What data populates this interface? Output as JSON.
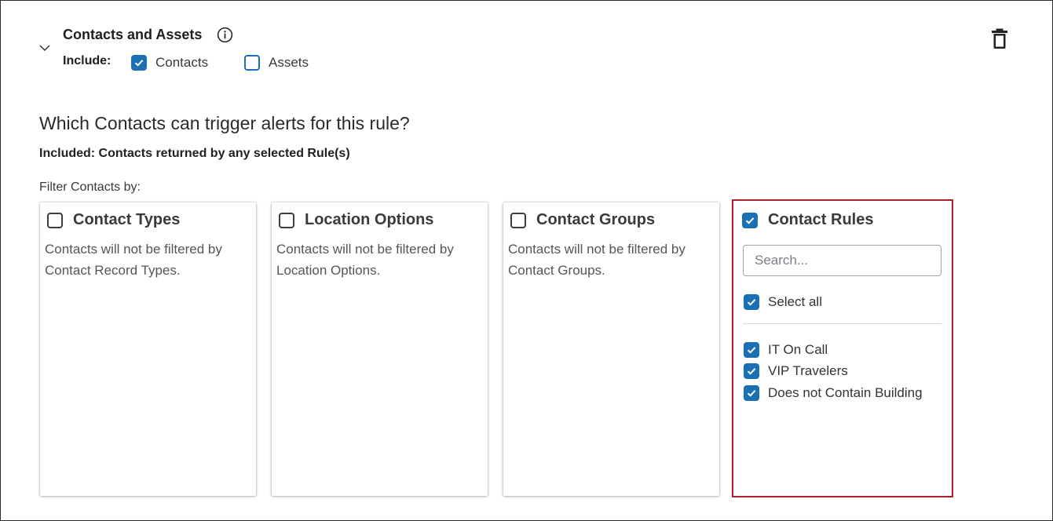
{
  "section": {
    "title": "Contacts and Assets",
    "include_label": "Include:",
    "include_options": [
      {
        "label": "Contacts",
        "checked": true
      },
      {
        "label": "Assets",
        "checked": false
      }
    ]
  },
  "question": "Which Contacts can trigger alerts for this rule?",
  "included_note": "Included: Contacts returned by any selected Rule(s)",
  "filter_label": "Filter Contacts by:",
  "cards": [
    {
      "title": "Contact Types",
      "checked": false,
      "description": "Contacts will not be filtered by Contact Record Types."
    },
    {
      "title": "Location Options",
      "checked": false,
      "description": "Contacts will not be filtered by Location Options."
    },
    {
      "title": "Contact Groups",
      "checked": false,
      "description": "Contacts will not be filtered by Contact Groups."
    }
  ],
  "contact_rules": {
    "title": "Contact Rules",
    "checked": true,
    "search_placeholder": "Search...",
    "select_all_label": "Select all",
    "select_all_checked": true,
    "items": [
      {
        "label": "IT On Call",
        "checked": true
      },
      {
        "label": "VIP Travelers",
        "checked": true
      },
      {
        "label": "Does not Contain Building",
        "checked": true
      }
    ]
  },
  "colors": {
    "accent": "#1a6fb5",
    "highlight_border": "#b0202a"
  },
  "icons": {
    "collapse": "chevron-down-icon",
    "info": "info-icon",
    "delete": "trash-icon",
    "check": "checkmark-icon"
  }
}
